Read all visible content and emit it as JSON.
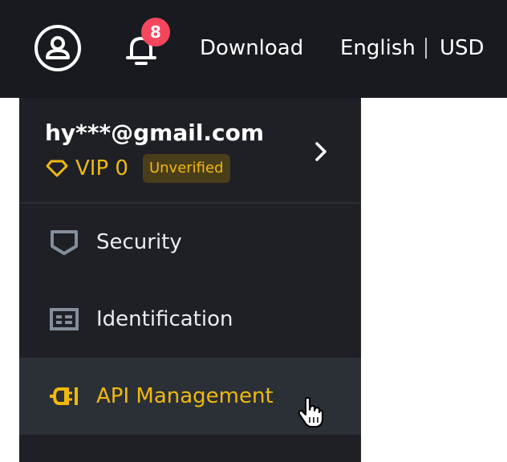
{
  "header": {
    "notification_count": "8",
    "download_label": "Download",
    "language_label": "English",
    "currency_label": "USD"
  },
  "account": {
    "email": "hy***@gmail.com",
    "vip_label": "VIP 0",
    "status_badge": "Unverified"
  },
  "menu": {
    "items": [
      {
        "label": "Security",
        "icon": "shield-icon"
      },
      {
        "label": "Identification",
        "icon": "id-card-icon"
      },
      {
        "label": "API Management",
        "icon": "plug-icon",
        "active": true
      }
    ]
  },
  "colors": {
    "topbar_bg": "#181a20",
    "panel_bg": "#1e2026",
    "active_bg": "#2b2f36",
    "accent": "#f0b90b",
    "badge_bg": "#f6465d"
  }
}
